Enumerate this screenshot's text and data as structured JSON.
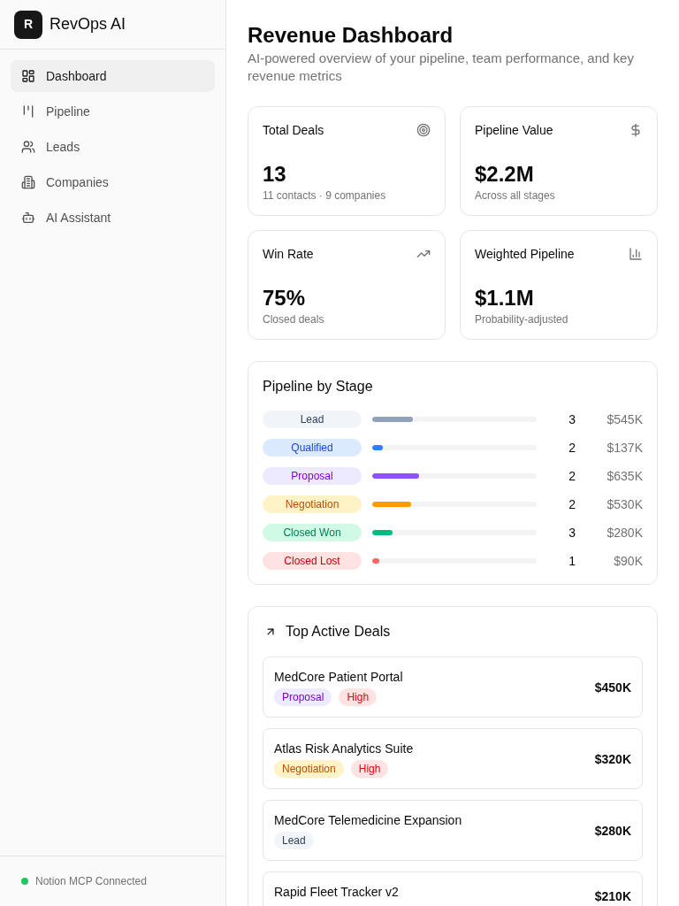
{
  "sidebar": {
    "logo": "R",
    "brand": "RevOps AI",
    "items": [
      {
        "label": "Dashboard",
        "selected": true
      },
      {
        "label": "Pipeline",
        "selected": false
      },
      {
        "label": "Leads",
        "selected": false
      },
      {
        "label": "Companies",
        "selected": false
      },
      {
        "label": "AI Assistant",
        "selected": false
      }
    ],
    "status": {
      "text": "Notion MCP Connected",
      "connected": true
    }
  },
  "page": {
    "title": "Revenue Dashboard",
    "subtitle": "AI-powered overview of your pipeline, team performance, and key revenue metrics"
  },
  "stats": [
    {
      "title": "Total Deals",
      "value": "13",
      "note": "11 contacts · 9 companies"
    },
    {
      "title": "Pipeline Value",
      "value": "$2.2M",
      "note": "Across all stages"
    },
    {
      "title": "Win Rate",
      "value": "75%",
      "note": "Closed deals"
    },
    {
      "title": "Weighted Pipeline",
      "value": "$1.1M",
      "note": "Probability-adjusted"
    }
  ],
  "pipeline_by_stage": {
    "title": "Pipeline by Stage",
    "stages": [
      {
        "label": "Lead",
        "color": "#90a1b9",
        "level": 0.246,
        "count": "3",
        "value": "$545K"
      },
      {
        "label": "Qualified",
        "color": "#2b7fff",
        "level": 0.062,
        "count": "2",
        "value": "$137K"
      },
      {
        "label": "Proposal",
        "color": "#8e51ff",
        "level": 0.286,
        "count": "2",
        "value": "$635K"
      },
      {
        "label": "Negotiation",
        "color": "#fe9a00",
        "level": 0.239,
        "count": "2",
        "value": "$530K"
      },
      {
        "label": "Closed Won",
        "color": "#00bc7d",
        "level": 0.126,
        "count": "3",
        "value": "$280K"
      },
      {
        "label": "Closed Lost",
        "color": "#ff6467",
        "level": 0.041,
        "count": "1",
        "value": "$90K"
      }
    ]
  },
  "top_deals": {
    "title": "Top Active Deals",
    "deals": [
      {
        "name": "MedCore Patient Portal",
        "amount": "$450K",
        "tags": [
          {
            "label": "Proposal",
            "color": "#8200db"
          },
          {
            "label": "High",
            "color": "#e7000b"
          }
        ]
      },
      {
        "name": "Atlas Risk Analytics Suite",
        "amount": "$320K",
        "tags": [
          {
            "label": "Negotiation",
            "color": "#bb4d00"
          },
          {
            "label": "High",
            "color": "#e7000b"
          }
        ]
      },
      {
        "name": "MedCore Telemedicine Expansion",
        "amount": "$280K",
        "tags": [
          {
            "label": "Lead",
            "color": "#314158"
          }
        ]
      },
      {
        "name": "Rapid Fleet Tracker v2",
        "amount": "$210K"
      }
    ]
  }
}
